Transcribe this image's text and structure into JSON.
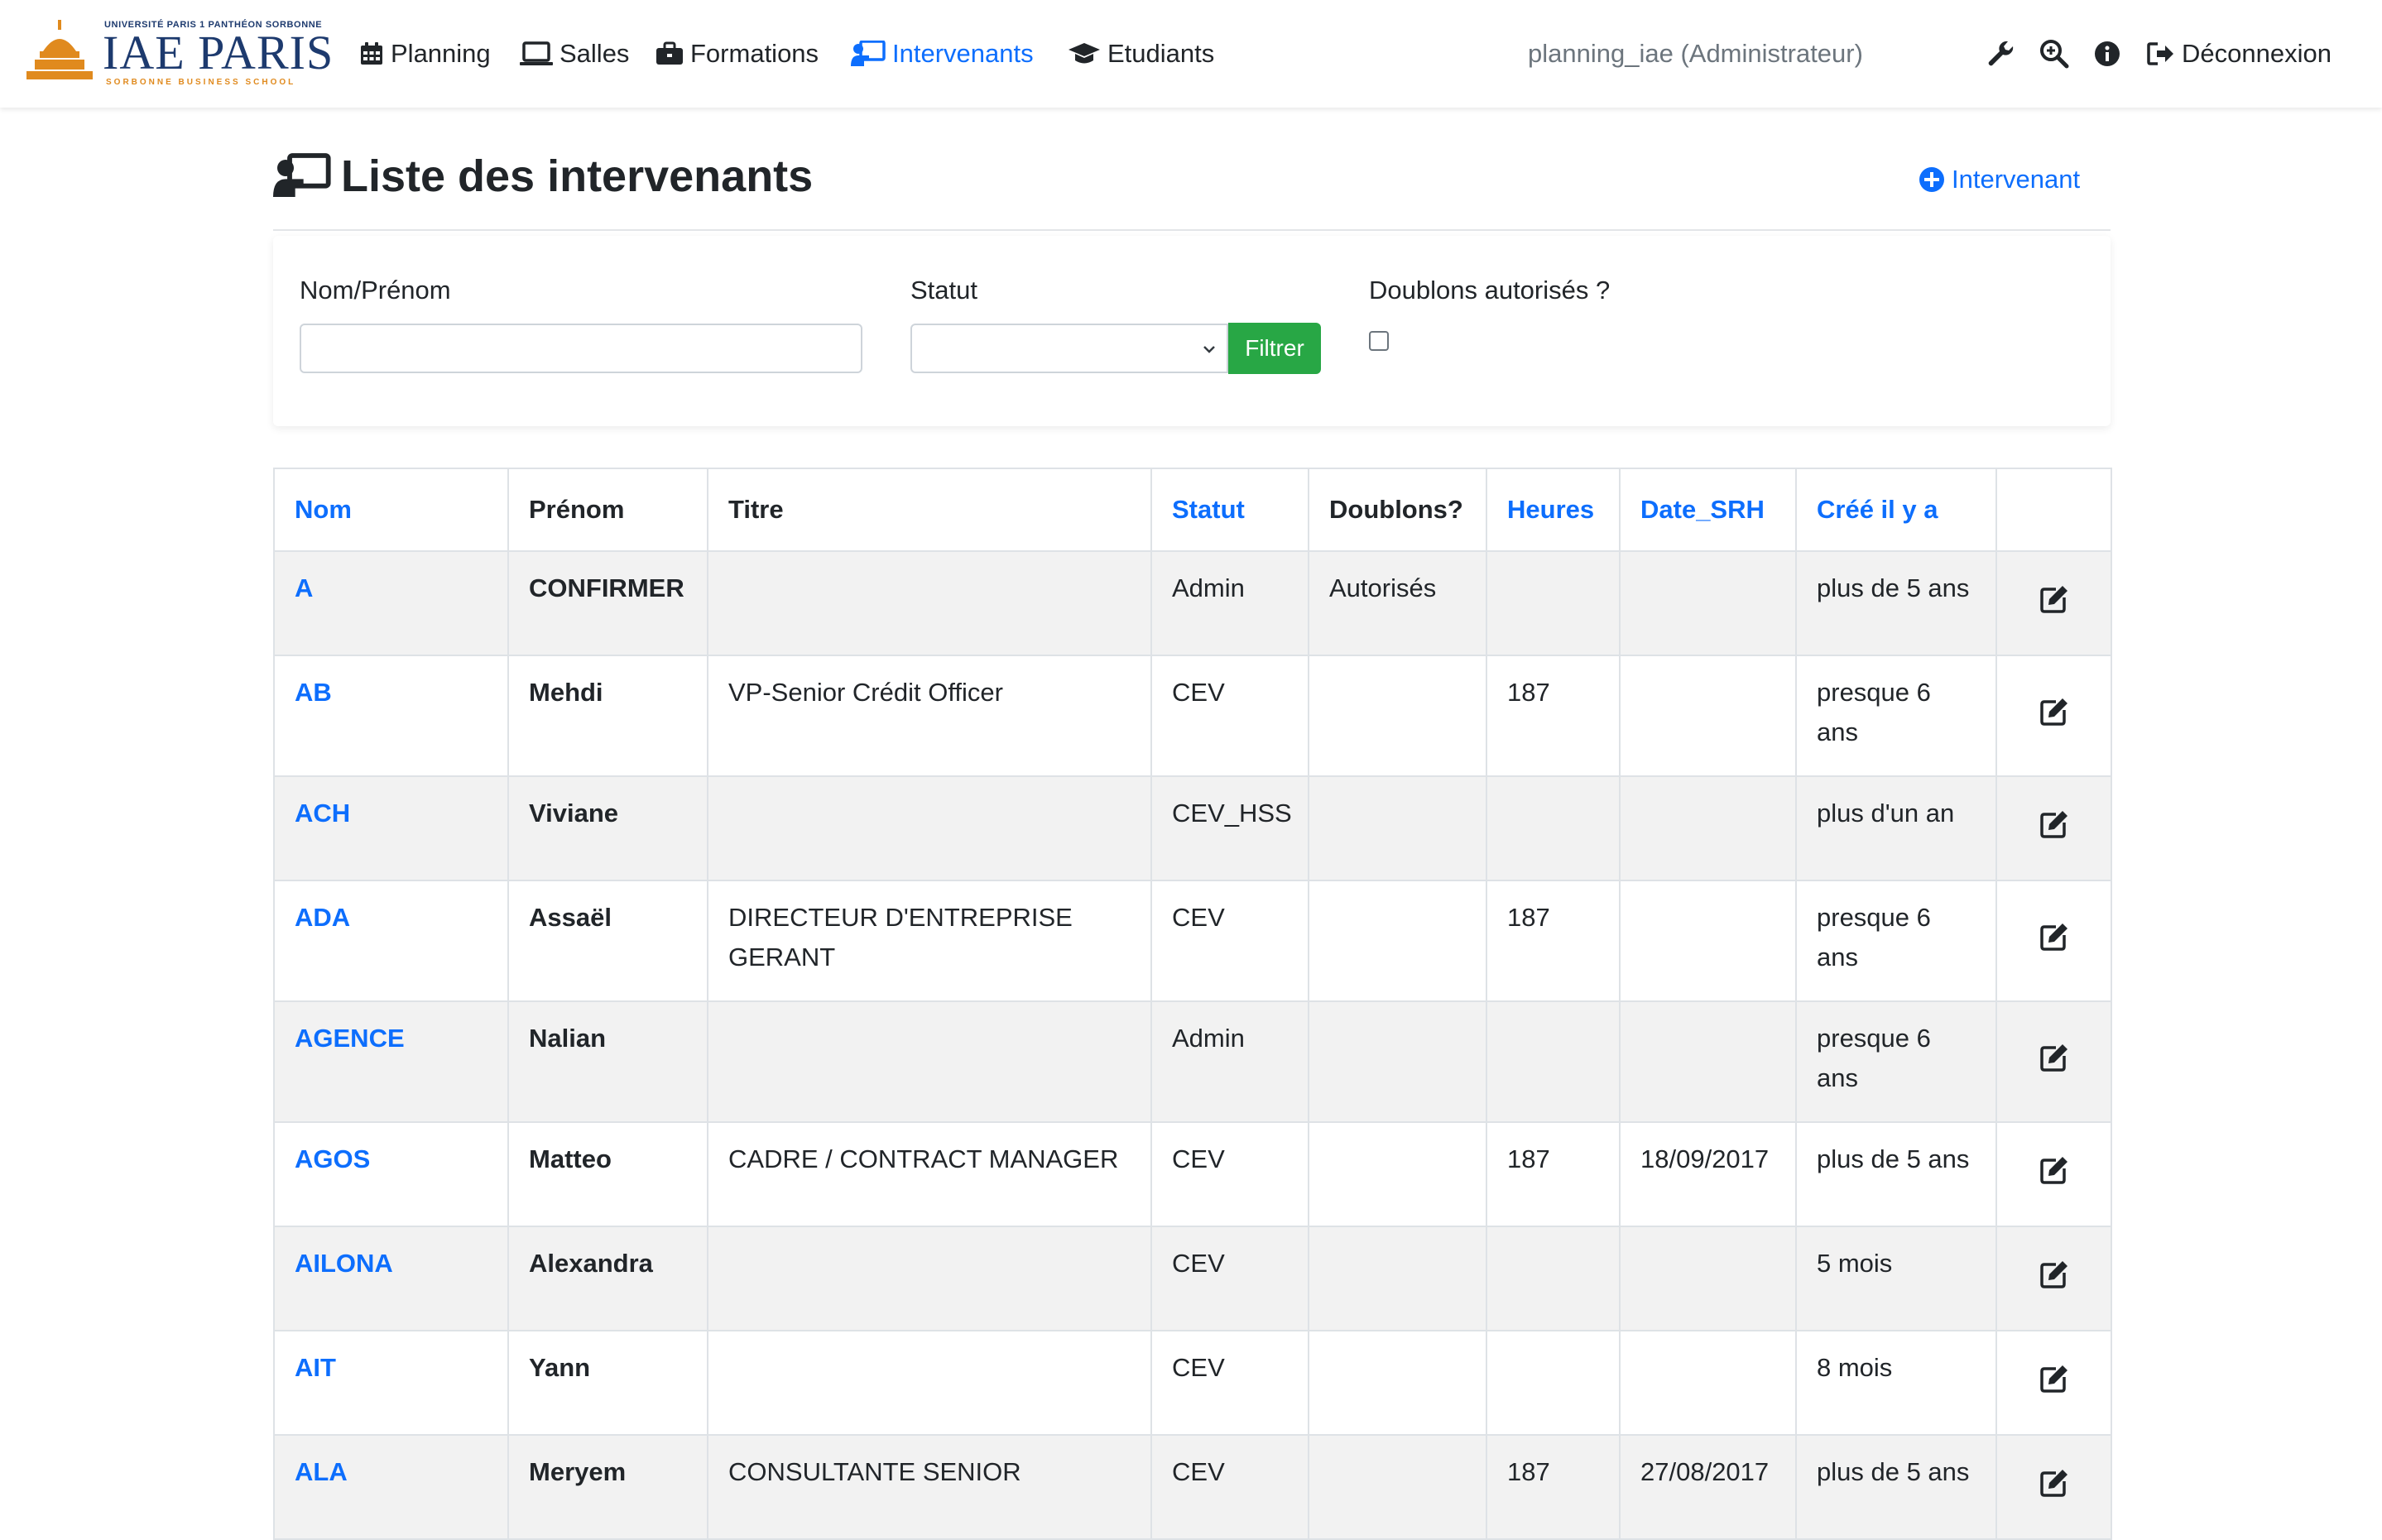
{
  "navbar": {
    "logo": {
      "top_text": "UNIVERSITÉ PARIS 1 PANTHÉON SORBONNE",
      "main_text": "IAE PARIS",
      "sub_text": "SORBONNE BUSINESS SCHOOL"
    },
    "items": [
      {
        "label": "Planning",
        "icon": "calendar-icon"
      },
      {
        "label": "Salles",
        "icon": "laptop-icon"
      },
      {
        "label": "Formations",
        "icon": "briefcase-icon"
      },
      {
        "label": "Intervenants",
        "icon": "chalkboard-teacher-icon",
        "active": true
      },
      {
        "label": "Etudiants",
        "icon": "graduation-cap-icon"
      }
    ],
    "user": "planning_iae (Administrateur)",
    "logout_label": "Déconnexion",
    "tool_icons": [
      "wrench-icon",
      "zoom-in-icon",
      "info-icon",
      "sign-out-icon"
    ]
  },
  "header": {
    "title": "Liste des intervenants",
    "add_label": "Intervenant"
  },
  "filters": {
    "name_label": "Nom/Prénom",
    "name_value": "",
    "status_label": "Statut",
    "status_value": "",
    "filter_button": "Filtrer",
    "duplicates_label": "Doublons autorisés ?",
    "duplicates_checked": false
  },
  "table": {
    "columns": [
      {
        "label": "Nom",
        "sortable": true
      },
      {
        "label": "Prénom",
        "sortable": false
      },
      {
        "label": "Titre",
        "sortable": false
      },
      {
        "label": "Statut",
        "sortable": true
      },
      {
        "label": "Doublons?",
        "sortable": false
      },
      {
        "label": "Heures",
        "sortable": true
      },
      {
        "label": "Date_SRH",
        "sortable": true
      },
      {
        "label": "Créé il y a",
        "sortable": true
      },
      {
        "label": "",
        "sortable": false
      }
    ],
    "rows": [
      {
        "nom": "A",
        "prenom": "CONFIRMER",
        "titre": "",
        "statut": "Admin",
        "doublons": "Autorisés",
        "heures": "",
        "date_srh": "",
        "cree": "plus de 5 ans"
      },
      {
        "nom": "AB",
        "prenom": "Mehdi",
        "titre": "VP-Senior Crédit Officer",
        "statut": "CEV",
        "doublons": "",
        "heures": "187",
        "date_srh": "",
        "cree": "presque 6 ans"
      },
      {
        "nom": "ACH",
        "prenom": "Viviane",
        "titre": "",
        "statut": "CEV_HSS",
        "doublons": "",
        "heures": "",
        "date_srh": "",
        "cree": "plus d'un an"
      },
      {
        "nom": "ADA",
        "prenom": "Assaël",
        "titre": "DIRECTEUR D'ENTREPRISE GERANT",
        "statut": "CEV",
        "doublons": "",
        "heures": "187",
        "date_srh": "",
        "cree": "presque 6 ans"
      },
      {
        "nom": "AGENCE",
        "prenom": "Nalian",
        "titre": "",
        "statut": "Admin",
        "doublons": "",
        "heures": "",
        "date_srh": "",
        "cree": "presque 6 ans"
      },
      {
        "nom": "AGOS",
        "prenom": "Matteo",
        "titre": "CADRE / CONTRACT MANAGER",
        "statut": "CEV",
        "doublons": "",
        "heures": "187",
        "date_srh": "18/09/2017",
        "cree": "plus de 5 ans"
      },
      {
        "nom": "AILONA",
        "prenom": "Alexandra",
        "titre": "",
        "statut": "CEV",
        "doublons": "",
        "heures": "",
        "date_srh": "",
        "cree": "5 mois"
      },
      {
        "nom": "AIT",
        "prenom": "Yann",
        "titre": "",
        "statut": "CEV",
        "doublons": "",
        "heures": "",
        "date_srh": "",
        "cree": "8 mois"
      },
      {
        "nom": "ALA",
        "prenom": "Meryem",
        "titre": "CONSULTANTE SENIOR",
        "statut": "CEV",
        "doublons": "",
        "heures": "187",
        "date_srh": "27/08/2017",
        "cree": "plus de 5 ans"
      }
    ]
  },
  "colors": {
    "accent": "#0d6efd",
    "button_success": "#28a745",
    "row_stripe": "#f2f2f2",
    "logo_navy": "#1d3a6e",
    "logo_orange": "#e08a1e"
  }
}
